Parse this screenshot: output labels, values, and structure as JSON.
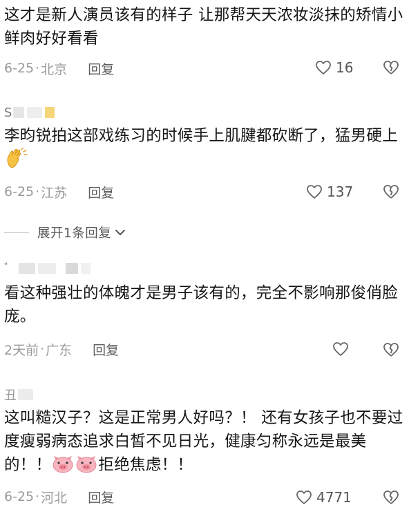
{
  "comments": [
    {
      "text": "这才是新人演员该有的样子 让那帮天天浓妆淡抹的矫情小鲜肉好好看看",
      "date": "6-25",
      "location": "北京",
      "reply_label": "回复",
      "likes": "16"
    },
    {
      "username_initial": "S",
      "text": "李昀锐拍这部戏练习的时候手上肌腱都砍断了，猛男硬上",
      "emoji": "clapping-hands",
      "date": "6-25",
      "location": "江苏",
      "reply_label": "回复",
      "likes": "137"
    },
    {
      "username_initial": "ﾞ",
      "text": "看这种强壮的体魄才是男子该有的，完全不影响那俊俏脸庞。",
      "date": "2天前",
      "location": "广东",
      "reply_label": "回复",
      "likes": ""
    },
    {
      "username_initial": "丑",
      "text_part1": "这叫糙汉子？这是正常男人好吗？！ 还有女孩子也不要过度瘦弱病态追求白皙不见日光，健康匀称永远是最美的！！",
      "text_part2": "拒绝焦虑！！",
      "emoji": "pig-face",
      "date": "6-25",
      "location": "河北",
      "reply_label": "回复",
      "likes": "4771"
    }
  ],
  "expand_replies": "展开1条回复",
  "separator": "·",
  "colors": {
    "meta": "#9a9a9a",
    "text": "#161616",
    "icon": "#666666"
  }
}
